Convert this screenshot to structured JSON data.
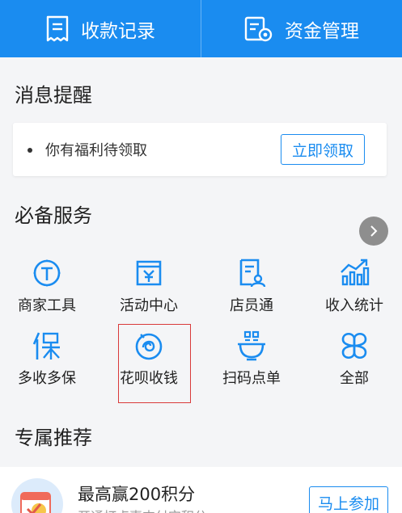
{
  "header": {
    "left_label": "收款记录",
    "right_label": "资金管理",
    "left_icon": "receipt-icon",
    "right_icon": "fund-settings-icon",
    "color": "#1a8cf0"
  },
  "messages": {
    "title": "消息提醒",
    "item_text": "你有福利待领取",
    "action_label": "立即领取"
  },
  "services": {
    "title": "必备服务",
    "items": [
      {
        "label": "商家工具",
        "icon": "merchant-tools-icon"
      },
      {
        "label": "活动中心",
        "icon": "activity-center-icon"
      },
      {
        "label": "店员通",
        "icon": "staff-icon"
      },
      {
        "label": "收入统计",
        "icon": "income-stats-icon"
      },
      {
        "label": "多收多保",
        "icon": "insurance-icon"
      },
      {
        "label": "花呗收钱",
        "icon": "huabei-icon"
      },
      {
        "label": "扫码点单",
        "icon": "scan-order-icon"
      },
      {
        "label": "全部",
        "icon": "all-apps-icon"
      }
    ],
    "highlighted": "花呗收钱"
  },
  "recommend": {
    "title": "专属推荐",
    "card_title": "最高赢200积分",
    "card_subtitle": "开通打点喜支付宝积分",
    "action_label": "马上参加"
  }
}
